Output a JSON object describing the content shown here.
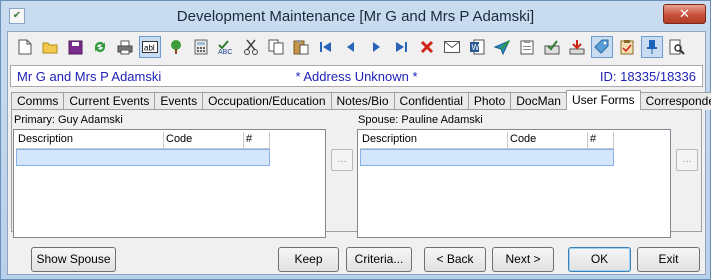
{
  "window": {
    "title": "Development Maintenance  [Mr G and Mrs P Adamski]",
    "close_label": "✕"
  },
  "toolbar": {
    "icons": [
      "new-document-icon",
      "open-folder-icon",
      "save-icon",
      "refresh-icon",
      "print-icon",
      "text-field-icon",
      "tree-icon",
      "calculator-icon",
      "spell-check-icon",
      "cut-icon",
      "copy-icon",
      "paste-icon",
      "first-record-icon",
      "previous-record-icon",
      "next-record-icon",
      "last-record-icon",
      "delete-icon",
      "mail-icon",
      "word-document-icon",
      "send-icon",
      "clipboard-icon",
      "approve-icon",
      "download-icon",
      "tag-icon",
      "checklist-icon",
      "pin-icon",
      "search-document-icon"
    ]
  },
  "infobar": {
    "name": "Mr G and Mrs P Adamski",
    "address_status": "* Address Unknown *",
    "id_label": "ID: 18335/18336"
  },
  "tabs": [
    {
      "label": "Comms",
      "active": false
    },
    {
      "label": "Current Events",
      "active": false
    },
    {
      "label": "Events",
      "active": false
    },
    {
      "label": "Occupation/Education",
      "active": false
    },
    {
      "label": "Notes/Bio",
      "active": false
    },
    {
      "label": "Confidential",
      "active": false
    },
    {
      "label": "Photo",
      "active": false
    },
    {
      "label": "DocMan",
      "active": false
    },
    {
      "label": "User Forms",
      "active": true
    },
    {
      "label": "Correspondence",
      "active": false
    }
  ],
  "primary": {
    "label": "Primary: Guy Adamski",
    "columns": [
      "Description",
      "Code",
      "#"
    ],
    "ellipsis": "..."
  },
  "spouse": {
    "label": "Spouse: Pauline Adamski",
    "columns": [
      "Description",
      "Code",
      "#"
    ],
    "ellipsis": "..."
  },
  "buttons": {
    "show_spouse": "Show Spouse",
    "keep": "Keep",
    "criteria": "Criteria...",
    "back": "< Back",
    "next": "Next >",
    "ok": "OK",
    "exit": "Exit"
  },
  "colors": {
    "info_text": "#1e22b8",
    "selection_row": "#d4e6fb"
  }
}
